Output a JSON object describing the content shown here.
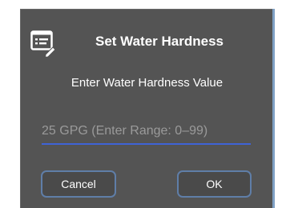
{
  "dialog": {
    "title": "Set Water Hardness",
    "title_icon": "edit-list-icon",
    "prompt": "Enter Water Hardness Value",
    "input": {
      "value": "",
      "placeholder": "25 GPG (Enter Range: 0–99)"
    },
    "buttons": {
      "cancel_label": "Cancel",
      "ok_label": "OK"
    }
  },
  "colors": {
    "dialog_background": "#545454",
    "input_underline": "#3f63d6",
    "button_border": "#5f7ea8",
    "text": "#ffffff",
    "placeholder": "#9a9a9a"
  }
}
